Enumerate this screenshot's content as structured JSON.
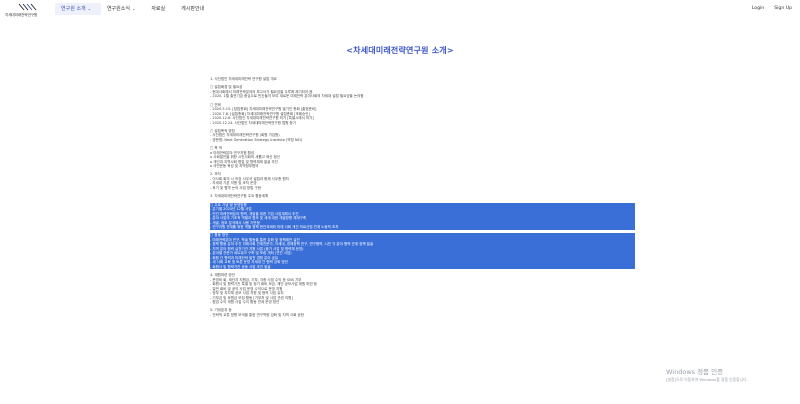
{
  "header": {
    "logo_text": "차세대미래전략연구원",
    "nav": [
      {
        "label": "연구원 소개",
        "dropdown": true,
        "active": true
      },
      {
        "label": "연구원소식",
        "dropdown": true,
        "active": false
      },
      {
        "label": "자료실",
        "dropdown": false,
        "active": false
      },
      {
        "label": "게시판안내",
        "dropdown": false,
        "active": false
      }
    ],
    "login": "Login",
    "signup": "Sign Up"
  },
  "page_title": "<차세대미래전략연구원 소개>",
  "content": {
    "blocks": [
      {
        "lines": [
          "1. 사단법인 차세대미래전략 연구원 설립 개요"
        ]
      },
      {
        "lines": [
          "□ 설립배경 및 필요성",
          "- 현대사회에서 미래전략분야의 보고서가 필요성을 두루에 제기되어 옴",
          "- 2020. 1월 출연기금 중심으로 민간들이 모여 새로운 미래전략 분야사회의 차세대 설립 필요성을 논의함"
        ]
      },
      {
        "lines": [
          "□ 연혁",
          "- 2020.5.15. [창립총회] 차세대미래전략연구원 발기인 총회 [출범준비]",
          "- 2020.7.8. [설립총회] 차세대미래전략연구원 설립총회 [조례승인]",
          "- 2020.12.8. 사단법인 차세대미래전략연구원 허가 [특별시에서 허가]",
          "- 2020.12.24. 사단법인 차세대미래전략연구원 법원 등기"
        ]
      },
      {
        "lines": [
          "□ 설립목적 명칭",
          "- 사단법인 차세대미래전략연구원 (회원 가입원)",
          "- 영문명: Next Generation Strategy Institute (약칭 NEI)"
        ]
      },
      {
        "lines": [
          "□ 목 적",
          "o 미래전략분야 연구지원 활성",
          "o 사회발전을 위한 시민사회의 새롭고 혁신 정신",
          "o 개인과 지역사회 협업 및 협력체제 발굴 추진",
          "o 국민운동 육성 및 지역정부협의"
        ]
      },
      {
        "lines": [
          "2. 조직",
          "- 이사회 회의 시 의장 사무국 설립과 함께 사무총 원칙",
          "- 차세대 기본 지원 및 조직 운영",
          "- 후기 및 협약 논의 사업 방법 구현"
        ]
      },
      {
        "lines": [
          "3. 차세대미래전략연구원 주요 활동계획"
        ]
      },
      {
        "selected": true,
        "lines": [
          "□ 주요 기념 및 운영방향",
          "- 분기별 2020년 12월 사업",
          "- 민간 미래전략분야 협력, 개발을 위한 기업 사업계획서 추진",
          "- 분야 사업의 기초적 역할과 협조 및 세계 대한 개발방향 체계구축",
          "- 개발, 정보 분석에서 사용 기반형",
          "- 연구지원 연계를 위한 역할 정책 현안과제와 미래 사회 개선 의료산업 연계 노동적 조치"
        ]
      },
      {
        "selected": true,
        "lines": [
          "□ 활동 방안",
          "- 미래전략분야 연구, 학술 활동을 통한 강화 및 정책제안 실천",
          "- 정책 활동 분야 추진 미래사회 관계전문가, 차세대, 경제정책 연구, 연구협력, 시민 각 분야 협력 관계 정책 발굴",
          "- 지역 분야 협력 실천기관 지원 사업 (중기 사업 및 협력체 운영)",
          "- 분야별 전문가 네트워크 구축 및 포럼 개최 (연간 사업)",
          "- 회원 간 협력과 미래전략 발전 경험 분야 공유",
          "- 새 사회 교육 및 토론 운영 차세대 간 협력 강화 방안",
          "- 회원사 및 협력기관 공동 사업 추진 발굴"
        ]
      },
      {
        "lines": [
          "4. 재원마련 방안",
          "- 운영비 회, 재단지 지원금, 기부, 각종 사업 수익 등 SNS 기부",
          "- 회원사 및 협력기관 특별 및 정기 회비 모금, 재단 공모사업 재원 마련 등",
          "- 일반 회비 및 공익 사업 운영 수익으로 운영 지원",
          "- 정부 및 지자체 공모 사업 지원 및 협력 사업 유치",
          "- 기부금 및 후원금 모집 활동 [기부처 및 사업 관련 지원]",
          "- 협업 수익 재원 사업 수익 활동 연계 운영 방안"
        ]
      },
      {
        "lines": [
          "5. 기대효과 등",
          "- 전략적 교류 방향 모색을 통한 연구역량 강화 및 지역 사회 공헌"
        ]
      }
    ]
  },
  "watermark": {
    "line1": "Windows 정품 인증",
    "line2": "[설정]으로 이동하여 Windows를 정품 인증합니다."
  }
}
